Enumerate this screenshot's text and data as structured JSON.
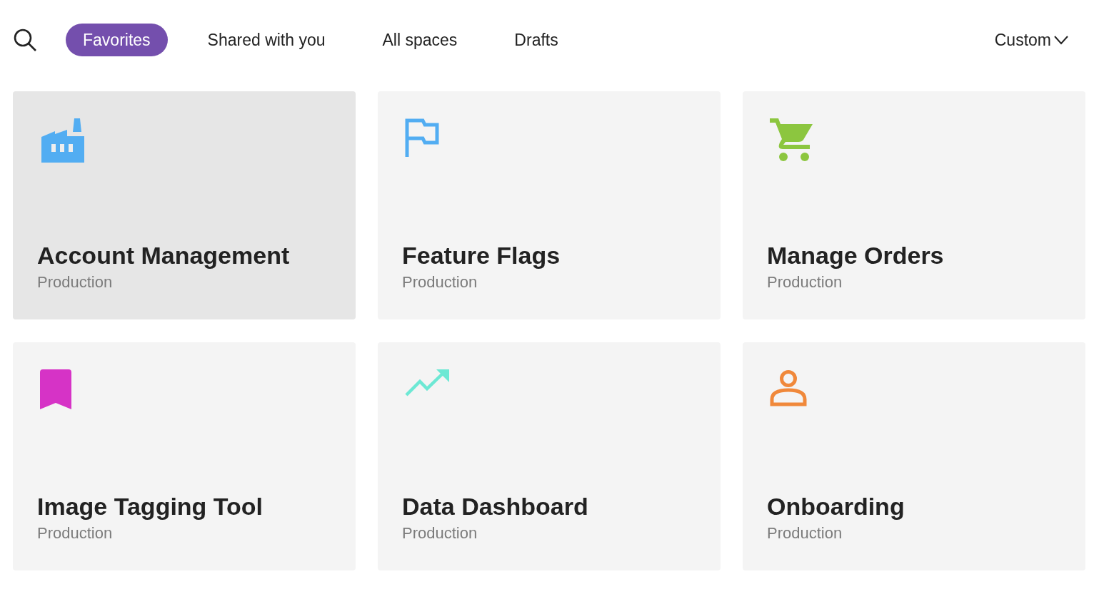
{
  "tabs": [
    {
      "label": "Favorites",
      "selected": true
    },
    {
      "label": "Shared with you",
      "selected": false
    },
    {
      "label": "All spaces",
      "selected": false
    },
    {
      "label": "Drafts",
      "selected": false
    }
  ],
  "sort_menu": {
    "label": "Custom"
  },
  "apps": [
    {
      "title": "Account Management",
      "environment": "Production",
      "kind": "factory",
      "color": "#52adf2",
      "highlighted": true
    },
    {
      "title": "Feature Flags",
      "environment": "Production",
      "kind": "flag",
      "color": "#52adf2",
      "highlighted": false
    },
    {
      "title": "Manage Orders",
      "environment": "Production",
      "kind": "cart",
      "color": "#8cc63f",
      "highlighted": false
    },
    {
      "title": "Image Tagging Tool",
      "environment": "Production",
      "kind": "bookmark",
      "color": "#d633c6",
      "highlighted": false
    },
    {
      "title": "Data Dashboard",
      "environment": "Production",
      "kind": "trend",
      "color": "#6de8d4",
      "highlighted": false
    },
    {
      "title": "Onboarding",
      "environment": "Production",
      "kind": "person",
      "color": "#f0883a",
      "highlighted": false
    }
  ]
}
